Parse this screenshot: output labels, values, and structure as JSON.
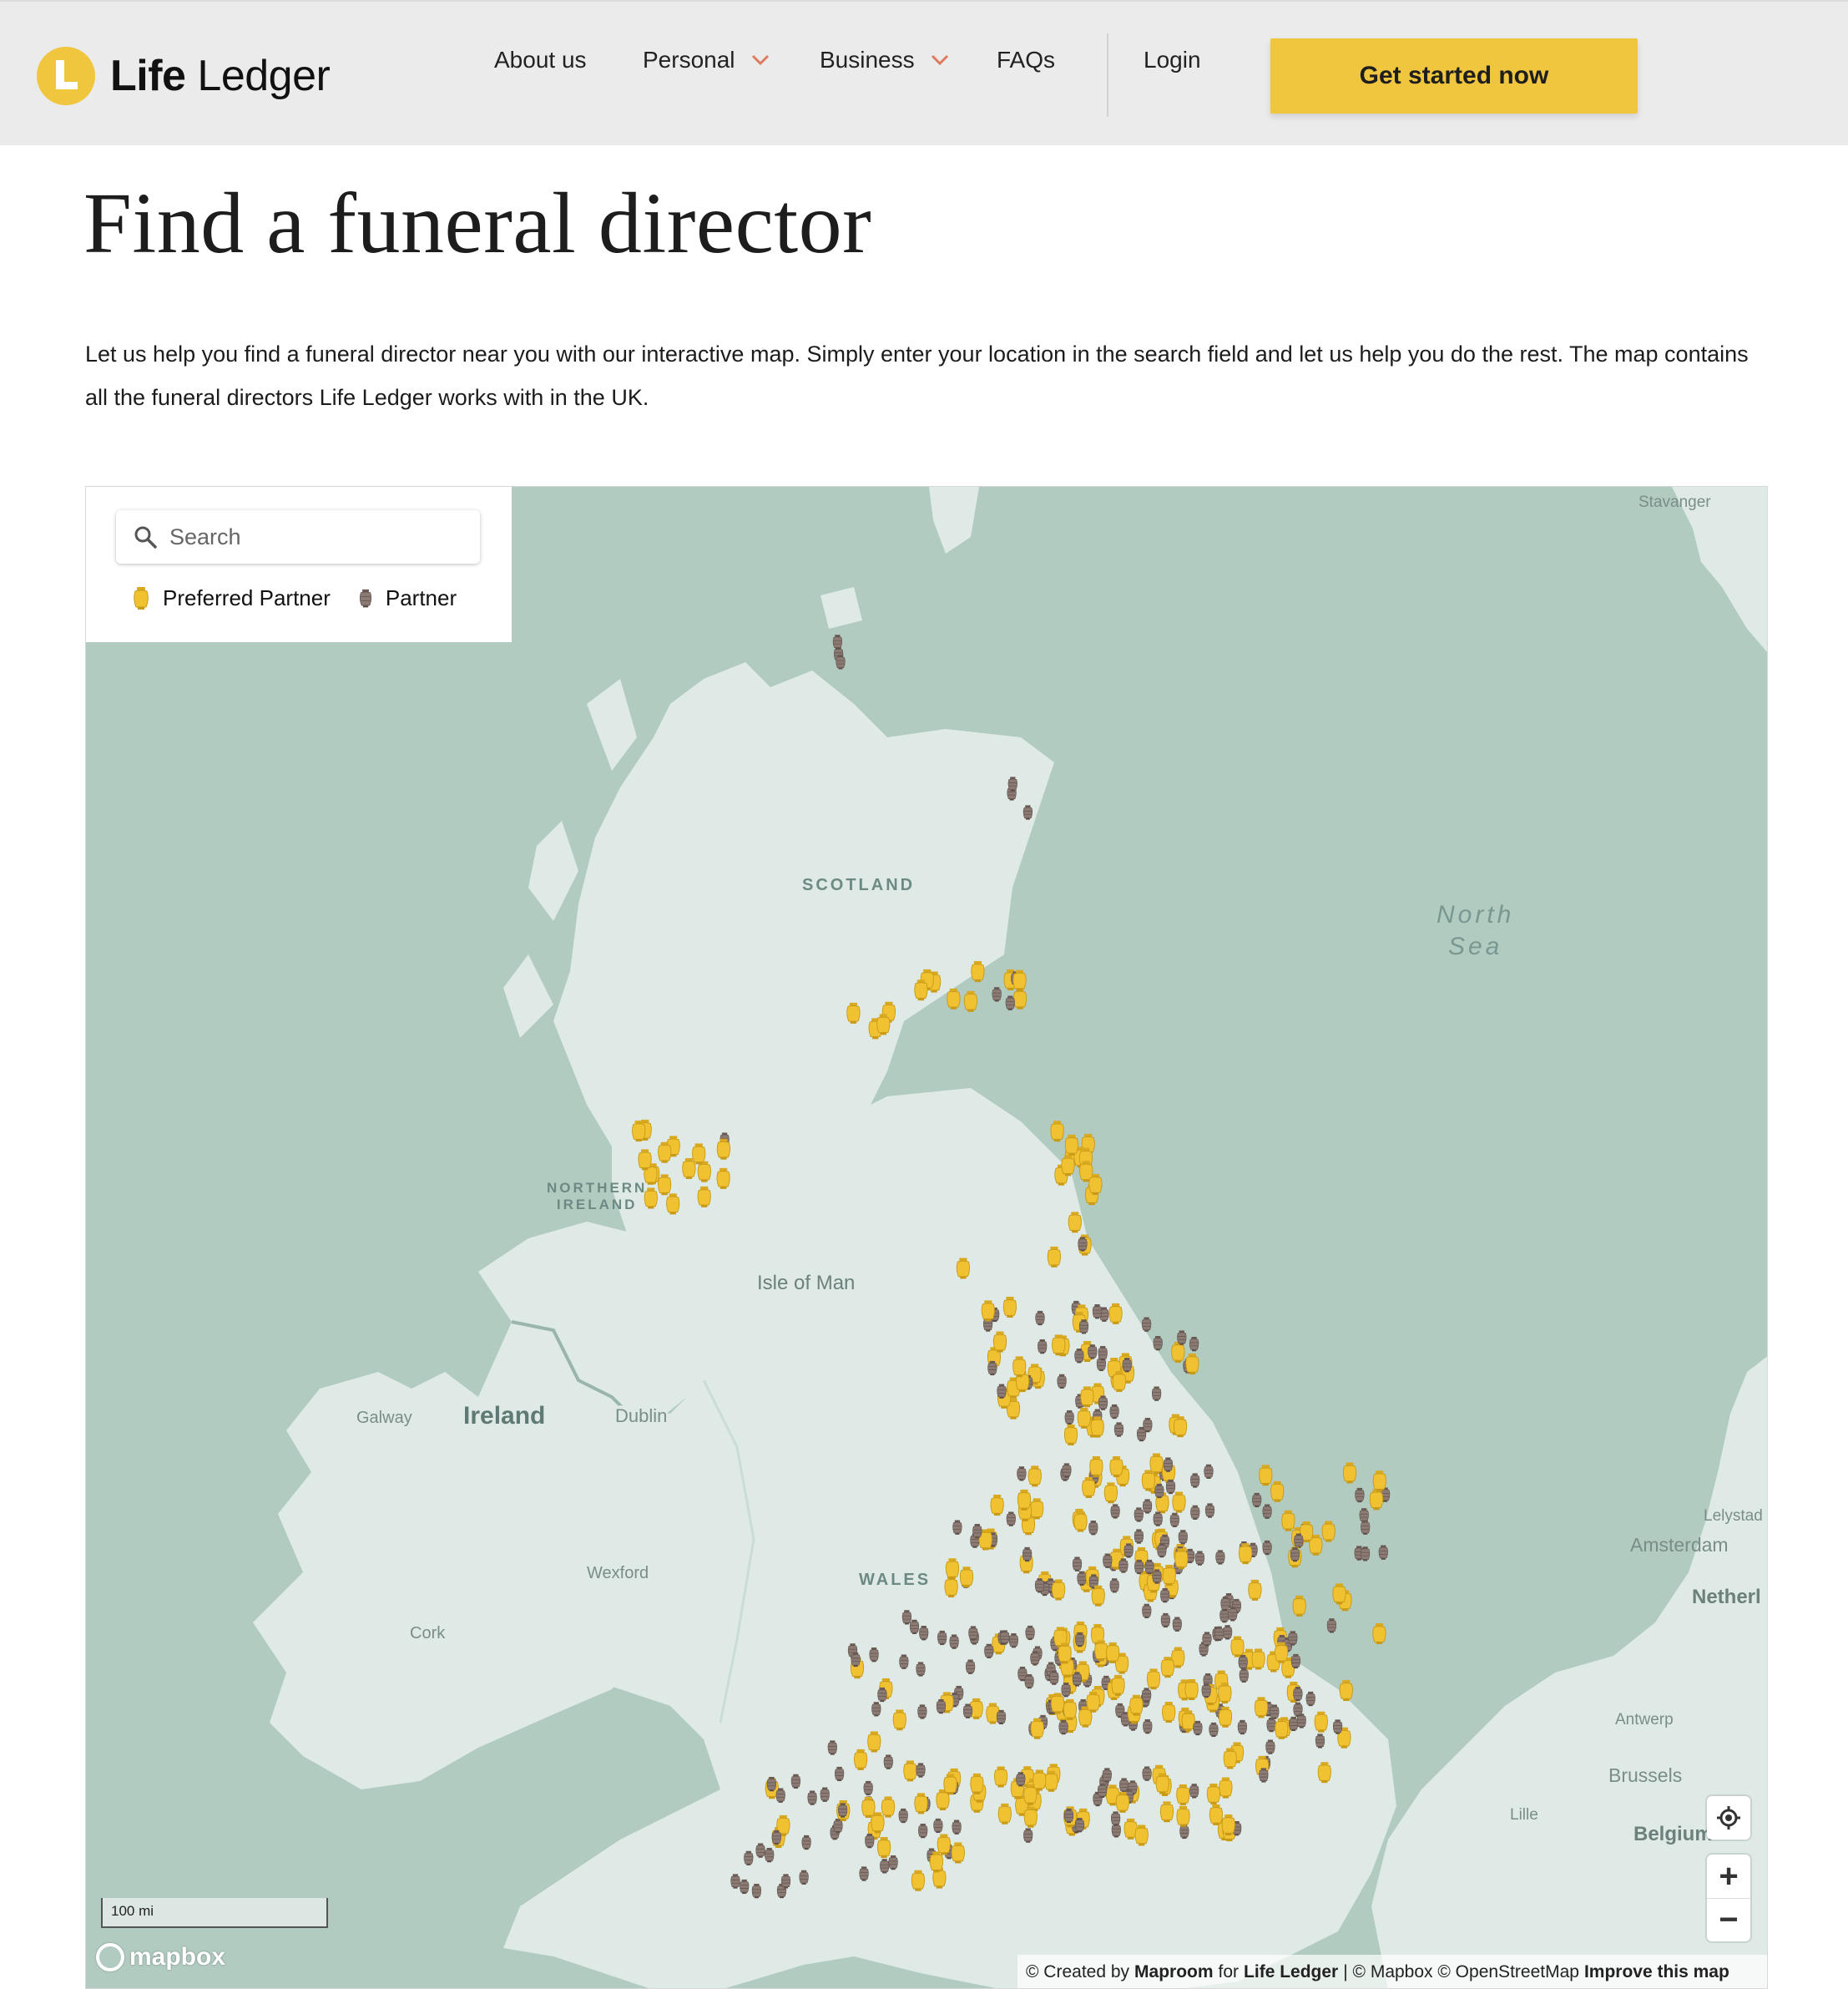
{
  "header": {
    "logo_bold": "Life",
    "logo_light": "Ledger",
    "nav": {
      "about": "About us",
      "personal": "Personal",
      "business": "Business",
      "faqs": "FAQs",
      "login": "Login"
    },
    "cta_label": "Get started now",
    "accent_color": "#efc63d",
    "chevron_color": "#e07a5f"
  },
  "page": {
    "title": "Find a funeral director",
    "intro": "Let us help you find a funeral director near you with our interactive map. Simply enter your location in the search field and let us help you do the rest. The map contains all the funeral directors Life Ledger works with in the UK."
  },
  "map": {
    "search": {
      "placeholder": "Search",
      "icon": "search-icon"
    },
    "legend": {
      "preferred": "Preferred Partner",
      "partner": "Partner",
      "preferred_color": "#f0c232",
      "partner_color": "#8c7b74"
    },
    "labels": {
      "stavanger": "Stavanger",
      "scotland": "SCOTLAND",
      "north_sea_1": "North",
      "north_sea_2": "Sea",
      "northern_ireland_1": "NORTHERN",
      "northern_ireland_2": "IRELAND",
      "isle_of_man": "Isle of Man",
      "galway": "Galway",
      "ireland": "Ireland",
      "dublin": "Dublin",
      "wexford": "Wexford",
      "cork": "Cork",
      "wales": "WALES",
      "lelystad": "Lelystad",
      "amsterdam": "Amsterdam",
      "netherlands": "Netherl",
      "antwerp": "Antwerp",
      "brussels": "Brussels",
      "lille": "Lille",
      "belgium": "Belgium"
    },
    "scale_label": "100 mi",
    "mapbox_label": "mapbox",
    "attribution": {
      "prefix": "© Created by",
      "maproom": "Maproom",
      "for": "for",
      "life_ledger": "Life Ledger",
      "rest": "| © Mapbox © OpenStreetMap",
      "improve": "Improve this map"
    },
    "controls": {
      "geolocate": "locate-icon",
      "zoom_in": "+",
      "zoom_out": "−"
    },
    "water_color": "#b1cbc0",
    "land_color": "#dfeae6"
  }
}
